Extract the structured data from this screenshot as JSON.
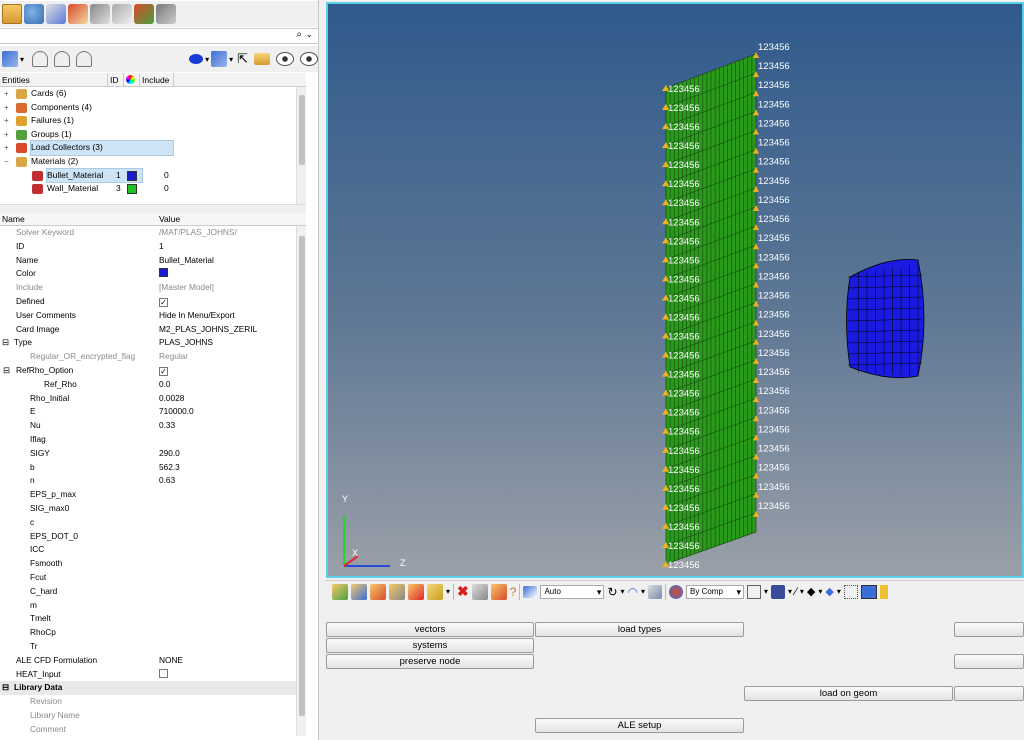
{
  "search": {
    "value": "",
    "placeholder": ""
  },
  "browser": {
    "headers": {
      "entities": "Entities",
      "id": "ID",
      "include": "Include"
    },
    "tree": [
      {
        "label": "Cards (6)",
        "indent": 0,
        "expand": "+",
        "icon_color": "#d8a646"
      },
      {
        "label": "Components (4)",
        "indent": 0,
        "expand": "+",
        "icon_color": "#d86b2d"
      },
      {
        "label": "Failures (1)",
        "indent": 0,
        "expand": "+",
        "icon_color": "#e0a030"
      },
      {
        "label": "Groups (1)",
        "indent": 0,
        "expand": "+",
        "icon_color": "#54a040"
      },
      {
        "label": "Load Collectors (3)",
        "indent": 0,
        "expand": "+",
        "icon_color": "#d84a2c",
        "selected": true
      },
      {
        "label": "Materials (2)",
        "indent": 0,
        "expand": "−",
        "icon_color": "#d8a646"
      },
      {
        "label": "Bullet_Material",
        "indent": 1,
        "id": "1",
        "color": "#1a1ad0",
        "include": "0",
        "icon_color": "#c03030",
        "selected": true
      },
      {
        "label": "Wall_Material",
        "indent": 1,
        "id": "3",
        "color": "#22c022",
        "include": "0",
        "icon_color": "#c03030"
      }
    ]
  },
  "properties": {
    "headers": {
      "name": "Name",
      "value": "Value"
    },
    "rows": [
      {
        "key": "Solver Keyword",
        "value": "/MAT/PLAS_JOHNS/",
        "indent": 1,
        "grey": true
      },
      {
        "key": "ID",
        "value": "1",
        "indent": 1
      },
      {
        "key": "Name",
        "value": "Bullet_Material",
        "indent": 1
      },
      {
        "key": "Color",
        "value": "",
        "indent": 1,
        "type": "color",
        "color": "#1a1ad0"
      },
      {
        "key": "Include",
        "value": "[Master Model]",
        "indent": 1,
        "grey": true
      },
      {
        "key": "Defined",
        "value": "",
        "indent": 1,
        "type": "check",
        "checked": true
      },
      {
        "key": "User Comments",
        "value": "Hide In Menu/Export",
        "indent": 1
      },
      {
        "key": "Card Image",
        "value": "M2_PLAS_JOHNS_ZERIL",
        "indent": 1
      },
      {
        "key": "Type",
        "value": "PLAS_JOHNS",
        "indent": 0,
        "expand": "⊟"
      },
      {
        "key": "Regular_OR_encrypted_flag",
        "value": "Regular",
        "indent": 2,
        "grey": true
      },
      {
        "key": "RefRho_Option",
        "value": "",
        "indent": 1,
        "type": "check",
        "checked": true,
        "expand": "⊟"
      },
      {
        "key": "Ref_Rho",
        "value": "0.0",
        "indent": 3
      },
      {
        "key": "Rho_Initial",
        "value": "0.0028",
        "indent": 2
      },
      {
        "key": "E",
        "value": "710000.0",
        "indent": 2
      },
      {
        "key": "Nu",
        "value": "0.33",
        "indent": 2
      },
      {
        "key": "Iflag",
        "value": "",
        "indent": 2
      },
      {
        "key": "SIGY",
        "value": "290.0",
        "indent": 2
      },
      {
        "key": "b",
        "value": "562.3",
        "indent": 2
      },
      {
        "key": "n",
        "value": "0.63",
        "indent": 2
      },
      {
        "key": "EPS_p_max",
        "value": "",
        "indent": 2
      },
      {
        "key": "SIG_max0",
        "value": "",
        "indent": 2
      },
      {
        "key": "c",
        "value": "",
        "indent": 2
      },
      {
        "key": "EPS_DOT_0",
        "value": "",
        "indent": 2
      },
      {
        "key": "ICC",
        "value": "",
        "indent": 2
      },
      {
        "key": "Fsmooth",
        "value": "",
        "indent": 2
      },
      {
        "key": "Fcut",
        "value": "",
        "indent": 2
      },
      {
        "key": "C_hard",
        "value": "",
        "indent": 2
      },
      {
        "key": "m",
        "value": "",
        "indent": 2
      },
      {
        "key": "Tmelt",
        "value": "",
        "indent": 2
      },
      {
        "key": "RhoCp",
        "value": "",
        "indent": 2
      },
      {
        "key": "Tr",
        "value": "",
        "indent": 2
      },
      {
        "key": "ALE CFD Formulation",
        "value": "NONE",
        "indent": 1
      },
      {
        "key": "HEAT_Input",
        "value": "",
        "indent": 1,
        "type": "check",
        "checked": false
      },
      {
        "key": "Library Data",
        "value": "",
        "indent": 0,
        "section": true,
        "expand": "⊟"
      },
      {
        "key": "Revision",
        "value": "",
        "indent": 2,
        "grey": true
      },
      {
        "key": "Library Name",
        "value": "",
        "indent": 2,
        "grey": true
      },
      {
        "key": "Comment",
        "value": "",
        "indent": 2,
        "grey": true
      }
    ]
  },
  "viewport": {
    "constraint_label": "123456",
    "axis": {
      "x": "X",
      "y": "Y",
      "z": "Z"
    },
    "wall_color": "#2a9a1a",
    "bullet_color": "#1a1ae0",
    "constraint_color": "#f0b020"
  },
  "toolbar": {
    "auto_select": "Auto",
    "by_comp_select": "By Comp"
  },
  "panel": {
    "buttons": {
      "vectors": "vectors",
      "load_types": "load types",
      "systems": "systems",
      "preserve_node": "preserve node",
      "load_on_geom": "load on geom",
      "ale_setup": "ALE setup"
    }
  }
}
